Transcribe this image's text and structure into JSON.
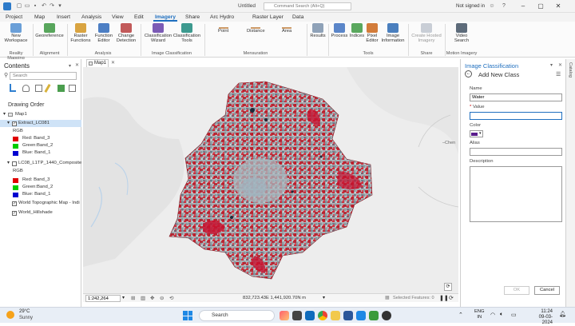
{
  "titlebar": {
    "title": "Untitled",
    "search_placeholder": "Command Search (Alt+Q)",
    "signin": "Not signed in"
  },
  "tabs": [
    "Project",
    "Map",
    "Insert",
    "Analysis",
    "View",
    "Edit",
    "Imagery",
    "Share",
    "Arc Hydro",
    "Raster Layer",
    "Data"
  ],
  "active_tab": "Imagery",
  "ribbon": {
    "new_workspace": "New\nWorkspace",
    "georeference": "Georeference",
    "raster_functions": "Raster\nFunctions",
    "function_editor": "Function\nEditor",
    "change_detection": "Change\nDetection",
    "classification_wizard": "Classification\nWizard",
    "classification_tools": "Classification\nTools",
    "point": "Point",
    "distance": "Distance",
    "area": "Area",
    "results": "Results",
    "process": "Process",
    "indices": "Indices",
    "pixel_editor": "Pixel\nEditor",
    "image_information": "Image\nInformation",
    "create_hosted_imagery": "Create Hosted\nImagery",
    "video_search": "Video\nSearch",
    "groups": {
      "reality_mapping": "Reality Mapping",
      "alignment": "Alignment",
      "analysis": "Analysis",
      "image_classification": "Image Classification",
      "mensuration": "Mensuration",
      "tools": "Tools",
      "share": "Share",
      "motion_imagery": "Motion Imagery"
    }
  },
  "contents": {
    "title": "Contents",
    "search_placeholder": "Search",
    "drawing_order": "Drawing Order",
    "map_name": "Map1",
    "layer1": "Extract_LC081",
    "rgb": "RGB",
    "red_band": "Red:  Band_3",
    "green_band": "Green:Band_2",
    "blue_band": "Blue:  Band_1",
    "layer2": "LC08_L1TP_1440_CompositeBa",
    "rgb2": "RGB",
    "red_band2": "Red:  Band_3",
    "green_band2": "Green:Band_2",
    "blue_band2": "Blue:  Band_1",
    "topo": "World Topographic Map - Indi",
    "hillshade": "World_Hillshade"
  },
  "map": {
    "tab": "Map1",
    "scale": "1:242,264",
    "coords": "832,723.43E 1,441,920.70N m",
    "selected_features": "Selected Features: 0",
    "place_label": "Tamil Nadu",
    "place_label2": "Hosur"
  },
  "image_classification": {
    "title": "Image Classification",
    "subtitle": "Add New Class",
    "name_label": "Name",
    "name_value": "Water",
    "value_label": "Value",
    "value_value": "",
    "color_label": "Color",
    "color_value": "#5a1d8c",
    "alias_label": "Alias",
    "alias_value": "",
    "description_label": "Description",
    "ok": "OK",
    "cancel": "Cancel"
  },
  "catalog_strip": "Catalog",
  "taskbar": {
    "temp": "29°C",
    "condition": "Sunny",
    "search": "Search",
    "lang1": "ENG",
    "lang2": "IN",
    "time": "11:24",
    "date": "09-03-2024"
  },
  "colors": {
    "accent": "#1f6fbf",
    "red_swatch": "#e00000",
    "green_swatch": "#00cc00",
    "blue_swatch": "#0000d0"
  }
}
